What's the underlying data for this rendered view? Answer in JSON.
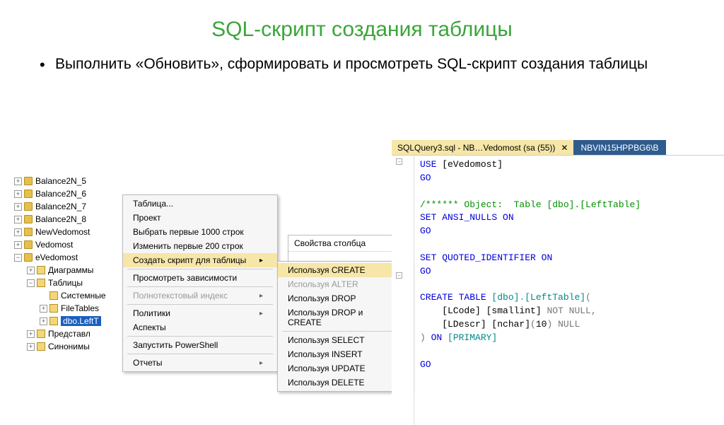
{
  "title": "SQL-скрипт создания таблицы",
  "bullet": "Выполнить «Обновить», сформировать и просмотреть SQL-скрипт создания таблицы",
  "tree": {
    "items": [
      {
        "exp": "+",
        "label": "Balance2N_5",
        "ind": 0
      },
      {
        "exp": "+",
        "label": "Balance2N_6",
        "ind": 0
      },
      {
        "exp": "+",
        "label": "Balance2N_7",
        "ind": 0
      },
      {
        "exp": "+",
        "label": "Balance2N_8",
        "ind": 0
      },
      {
        "exp": "+",
        "label": "NewVedomost",
        "ind": 0
      },
      {
        "exp": "+",
        "label": "Vedomost",
        "ind": 0
      },
      {
        "exp": "−",
        "label": "eVedomost",
        "ind": 0
      },
      {
        "exp": "+",
        "label": "Диаграммы",
        "ind": 1,
        "fld": true
      },
      {
        "exp": "−",
        "label": "Таблицы",
        "ind": 1,
        "fld": true
      },
      {
        "exp": "",
        "label": "Системные",
        "ind": 2,
        "fld": true
      },
      {
        "exp": "+",
        "label": "FileTables",
        "ind": 2,
        "fld": true
      },
      {
        "exp": "+",
        "label": "dbo.LeftT",
        "ind": 2,
        "fld": true,
        "sel": true
      },
      {
        "exp": "+",
        "label": "Представл",
        "ind": 1,
        "fld": true
      },
      {
        "exp": "+",
        "label": "Синонимы",
        "ind": 1,
        "fld": true
      }
    ]
  },
  "menu1": {
    "items": [
      {
        "label": "Таблица...",
        "type": "item"
      },
      {
        "label": "Проект",
        "type": "item"
      },
      {
        "label": "Выбрать первые 1000 строк",
        "type": "item"
      },
      {
        "label": "Изменить первые 200 строк",
        "type": "item"
      },
      {
        "label": "Создать скрипт для таблицы",
        "type": "item",
        "sub": true,
        "hl": true
      },
      {
        "type": "sep"
      },
      {
        "label": "Просмотреть зависимости",
        "type": "item"
      },
      {
        "type": "sep"
      },
      {
        "label": "Полнотекстовый индекс",
        "type": "item",
        "sub": true,
        "dis": true
      },
      {
        "type": "sep"
      },
      {
        "label": "Политики",
        "type": "item",
        "sub": true
      },
      {
        "label": "Аспекты",
        "type": "item"
      },
      {
        "type": "sep"
      },
      {
        "label": "Запустить PowerShell",
        "type": "item"
      },
      {
        "type": "sep"
      },
      {
        "label": "Отчеты",
        "type": "item",
        "sub": true
      }
    ]
  },
  "colprops": {
    "title": "Свойства столбца"
  },
  "menu2": {
    "items": [
      {
        "label": "Используя CREATE",
        "sub": true,
        "hl": true
      },
      {
        "label": "Используя ALTER",
        "sub": true,
        "dis": true
      },
      {
        "label": "Используя DROP",
        "sub": true
      },
      {
        "label": "Используя DROP и CREATE",
        "sub": true
      },
      {
        "type": "sep"
      },
      {
        "label": "Используя SELECT",
        "sub": true
      },
      {
        "label": "Используя INSERT",
        "sub": true
      },
      {
        "label": "Используя UPDATE",
        "sub": true
      },
      {
        "label": "Используя DELETE",
        "sub": true
      }
    ]
  },
  "tabs": {
    "active": "SQLQuery3.sql - NB…Vedomost (sa (55))",
    "close": "✕",
    "other": "NBVIN15HPPBG6\\B"
  },
  "code": {
    "l1a": "USE",
    "l1b": " [eVedomost]",
    "l2": "GO",
    "l3a": "/****** ",
    "l3b": "Object:  Table [dbo].[LeftTable]",
    "l4a": "SET",
    "l4b": " ANSI_NULLS ",
    "l4c": "ON",
    "l5": "GO",
    "l6a": "SET",
    "l6b": " QUOTED_IDENTIFIER ",
    "l6c": "ON",
    "l7": "GO",
    "l8a": "CREATE",
    "l8b": " TABLE",
    "l8c": " [dbo]",
    "l8d": ".",
    "l8e": "[LeftTable]",
    "l8f": "(",
    "l9a": "    [LCode] [smallint] ",
    "l9b": "NOT NULL",
    "l9c": ",",
    "l10a": "    [LDescr] [nchar]",
    "l10b": "(",
    "l10c": "10",
    "l10d": ")",
    "l10e": " NULL",
    "l11a": ")",
    "l11b": " ON",
    "l11c": " [PRIMARY]",
    "l12": "GO"
  }
}
